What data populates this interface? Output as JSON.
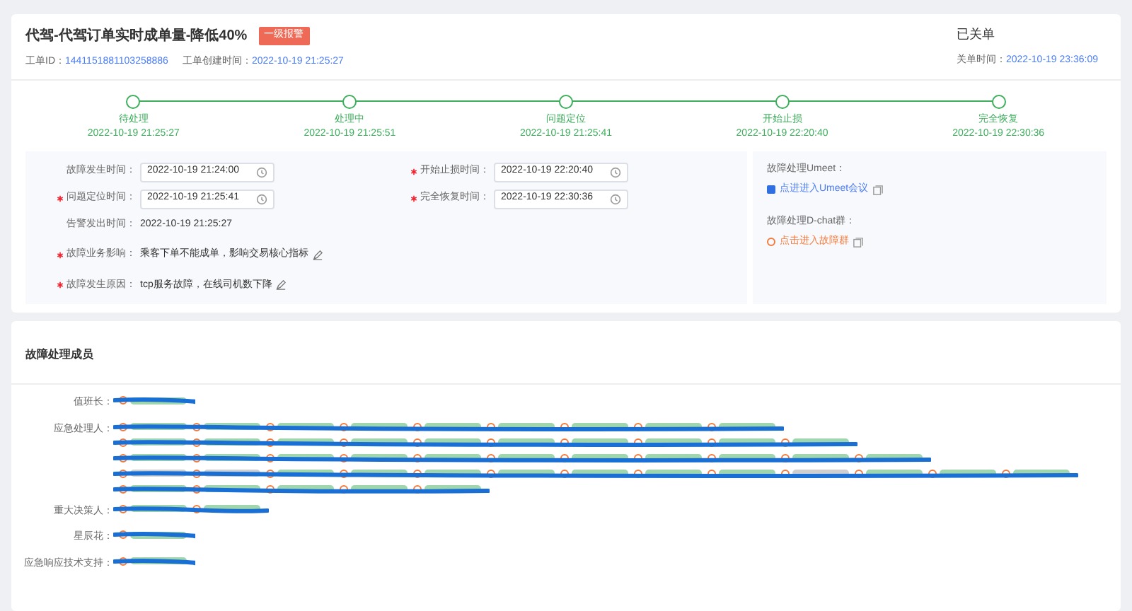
{
  "header": {
    "title": "代驾-代驾订单实时成单量-降低40%",
    "badge": "一级报警",
    "id_label": "工单ID：",
    "id_value": "1441151881103258886",
    "created_label": "工单创建时间：",
    "created_value": "2022-10-19 21:25:27",
    "status": "已关单",
    "closed_label": "关单时间：",
    "closed_value": "2022-10-19 23:36:09"
  },
  "timeline": [
    {
      "label": "待处理",
      "time": "2022-10-19 21:25:27",
      "done": true
    },
    {
      "label": "处理中",
      "time": "2022-10-19 21:25:51",
      "done": true
    },
    {
      "label": "问题定位",
      "time": "2022-10-19 21:25:41",
      "done": true
    },
    {
      "label": "开始止损",
      "time": "2022-10-19 22:20:40",
      "done": true
    },
    {
      "label": "完全恢复",
      "time": "2022-10-19 22:30:36",
      "done": true
    }
  ],
  "details": {
    "time_fields": [
      {
        "label": "故障发生时间：",
        "value": "2022-10-19 21:24:00",
        "required": false
      },
      {
        "label": "开始止损时间：",
        "value": "2022-10-19 22:20:40",
        "required": true
      },
      {
        "label": "问题定位时间：",
        "value": "2022-10-19 21:25:41",
        "required": true
      },
      {
        "label": "完全恢复时间：",
        "value": "2022-10-19 22:30:36",
        "required": true
      }
    ],
    "alert_time": {
      "label": "告警发出时间：",
      "value": "2022-10-19 21:25:27"
    },
    "text_fields": [
      {
        "label": "故障业务影响：",
        "value": "乘客下单不能成单，影响交易核心指标",
        "required": true
      },
      {
        "label": "故障发生原因：",
        "value": "tcp服务故障，在线司机数下降",
        "required": true
      }
    ]
  },
  "links": [
    {
      "label": "故障处理Umeet：",
      "link": "点进进入Umeet会议",
      "kind": "umeet"
    },
    {
      "label": "故障处理D-chat群：",
      "link": "点击进入故障群",
      "kind": "dchat"
    }
  ],
  "members": {
    "title": "故障处理成员",
    "roles": [
      {
        "label": "值班长：",
        "rows": [
          {
            "signed": [
              true
            ]
          }
        ]
      },
      {
        "label": "应急处理人：",
        "rows": [
          {
            "signed": [
              true,
              true,
              true,
              true,
              true,
              true,
              true,
              true,
              true
            ]
          },
          {
            "signed": [
              true,
              true,
              true,
              true,
              true,
              true,
              true,
              true,
              true,
              true
            ]
          },
          {
            "signed": [
              true,
              true,
              true,
              true,
              true,
              true,
              true,
              true,
              true,
              true,
              true
            ]
          },
          {
            "signed": [
              false,
              false,
              true,
              true,
              true,
              true,
              true,
              true,
              true,
              false,
              true,
              true,
              true
            ]
          },
          {
            "signed": [
              true,
              true,
              true,
              true,
              true
            ]
          }
        ]
      },
      {
        "label": "重大决策人：",
        "rows": [
          {
            "signed": [
              true,
              true
            ]
          }
        ]
      },
      {
        "label": "星辰花：",
        "rows": [
          {
            "signed": [
              true
            ]
          }
        ]
      },
      {
        "label": "应急响应技术支持：",
        "rows": [
          {
            "signed": [
              true
            ]
          }
        ]
      }
    ]
  }
}
